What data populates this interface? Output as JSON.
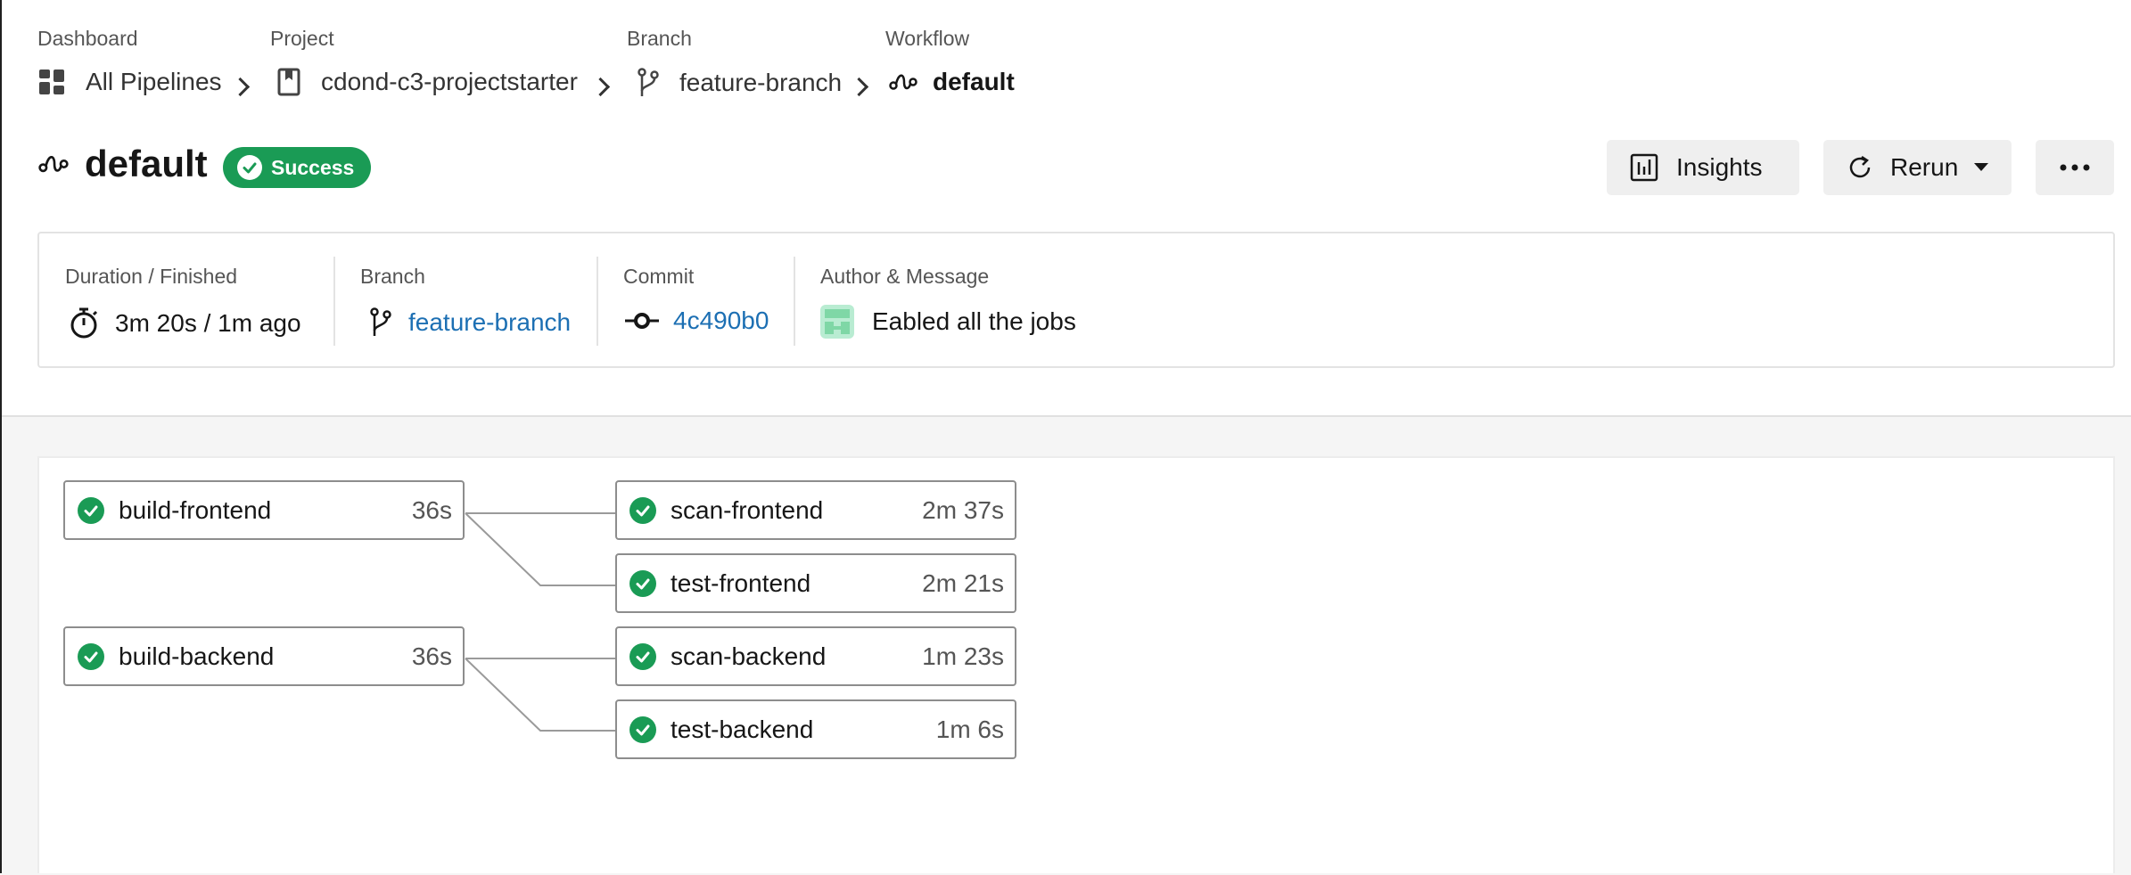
{
  "breadcrumb": [
    {
      "label": "Dashboard",
      "value": "All Pipelines",
      "icon": "dashboard-grid-icon"
    },
    {
      "label": "Project",
      "value": "cdond-c3-projectstarter",
      "icon": "project-bookmark-icon"
    },
    {
      "label": "Branch",
      "value": "feature-branch",
      "icon": "branch-icon"
    },
    {
      "label": "Workflow",
      "value": "default",
      "icon": "workflow-icon"
    }
  ],
  "header": {
    "title": "default",
    "status": "Success",
    "status_color": "#1a9b55",
    "insights_label": "Insights",
    "rerun_label": "Rerun"
  },
  "summary": {
    "duration": {
      "label": "Duration / Finished",
      "value": "3m 20s / 1m ago"
    },
    "branch": {
      "label": "Branch",
      "value": "feature-branch"
    },
    "commit": {
      "label": "Commit",
      "value": "4c490b0"
    },
    "author": {
      "label": "Author & Message",
      "value": "Eabled all the jobs"
    }
  },
  "jobs": [
    {
      "name": "build-frontend",
      "duration": "36s",
      "status": "success"
    },
    {
      "name": "scan-frontend",
      "duration": "2m 37s",
      "status": "success"
    },
    {
      "name": "test-frontend",
      "duration": "2m 21s",
      "status": "success"
    },
    {
      "name": "build-backend",
      "duration": "36s",
      "status": "success"
    },
    {
      "name": "scan-backend",
      "duration": "1m 23s",
      "status": "success"
    },
    {
      "name": "test-backend",
      "duration": "1m 6s",
      "status": "success"
    }
  ],
  "colors": {
    "accent_link": "#1c6fb3",
    "success": "#1a9b55"
  }
}
